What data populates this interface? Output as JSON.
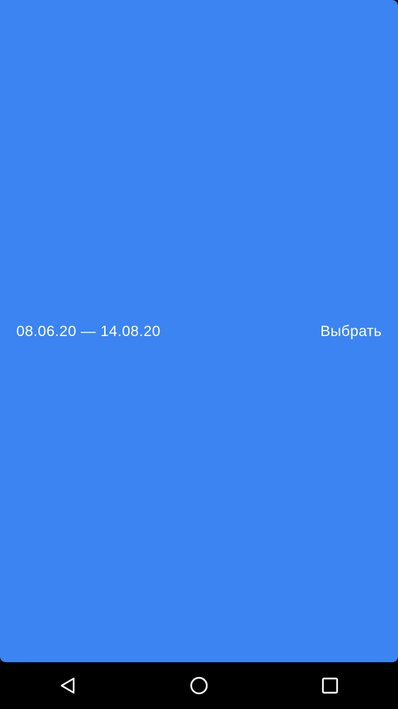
{
  "colors": {
    "sheet_background": "#3B84F2",
    "text": "#FFFFFF",
    "navbar_background": "#000000",
    "navbar_icons": "#FFFFFF"
  },
  "bottom_bar": {
    "date_range": "08.06.20 — 14.08.20",
    "choose_label": "Выбрать"
  },
  "system_nav": {
    "back_icon": "back-triangle-icon",
    "home_icon": "home-circle-icon",
    "recents_icon": "recents-square-icon"
  }
}
